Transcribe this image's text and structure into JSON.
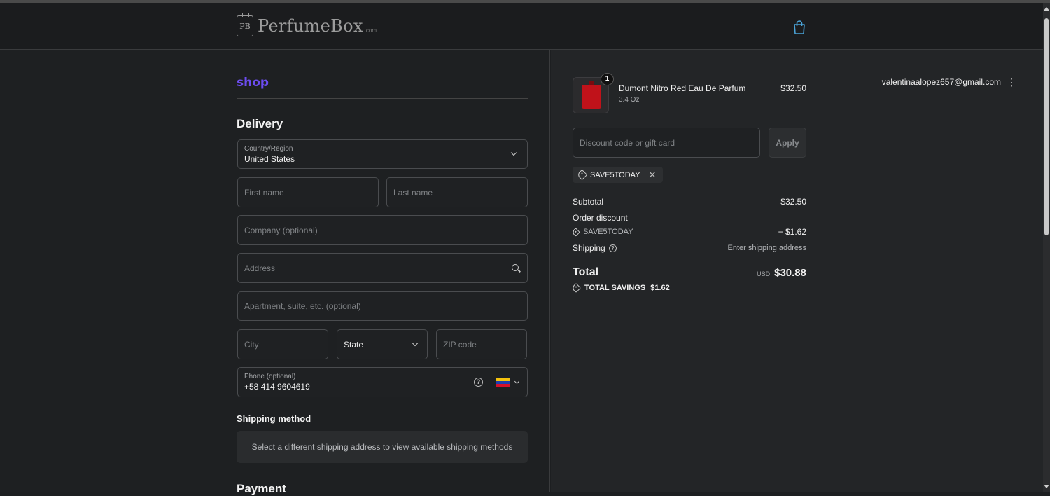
{
  "header": {
    "logo_mark": "PB",
    "logo_text": "PerfumeBox",
    "logo_sub": ".com"
  },
  "account": {
    "shop_label": "shop",
    "email": "valentinaalopez657@gmail.com",
    "menu_glyph": "⋮"
  },
  "delivery": {
    "title": "Delivery",
    "country_label": "Country/Region",
    "country_value": "United States",
    "first_name_ph": "First name",
    "last_name_ph": "Last name",
    "company_ph": "Company (optional)",
    "address_ph": "Address",
    "apartment_ph": "Apartment, suite, etc. (optional)",
    "city_ph": "City",
    "state_value": "State",
    "zip_ph": "ZIP code",
    "phone_label": "Phone (optional)",
    "phone_value": "+58 414 9604619",
    "phone_flag": "venezuela-flag"
  },
  "shipping": {
    "title": "Shipping method",
    "notice": "Select a different shipping address to view available shipping methods"
  },
  "payment": {
    "title": "Payment"
  },
  "order": {
    "item": {
      "name": "Dumont Nitro Red Eau De Parfum",
      "variant": "3.4 Oz",
      "price": "$32.50",
      "quantity": "1"
    },
    "discount_placeholder": "Discount code or gift card",
    "apply_label": "Apply",
    "applied_code": "SAVE5TODAY",
    "subtotal_label": "Subtotal",
    "subtotal_value": "$32.50",
    "order_discount_label": "Order discount",
    "discount_code": "SAVE5TODAY",
    "discount_value": "− $1.62",
    "shipping_label": "Shipping",
    "shipping_value": "Enter shipping address",
    "total_label": "Total",
    "currency": "USD",
    "total_value": "$30.88",
    "savings_label": "TOTAL SAVINGS",
    "savings_value": "$1.62"
  },
  "colors": {
    "shop_accent": "#6c4cf0",
    "bag_icon": "#4aa3d8"
  }
}
